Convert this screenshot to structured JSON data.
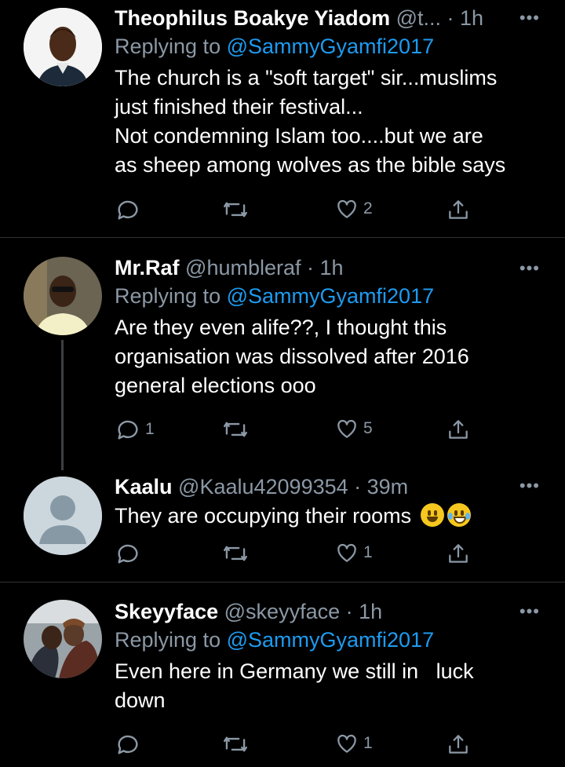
{
  "tweets": [
    {
      "name": "Theophilus Boakye Yiadom",
      "handle": "@t...",
      "time": "· 1h",
      "reply_label": "Replying to",
      "reply_handle": "@SammyGyamfi2017",
      "body_lines": [
        "The church is a \"soft target\" sir...muslims",
        "just finished their festival...",
        "Not condemning Islam too....but we are",
        "as sheep among wolves as the bible says"
      ],
      "replies": "",
      "retweets": "",
      "likes": "2"
    },
    {
      "name": "Mr.Raf",
      "handle": "@humbleraf",
      "time": "· 1h",
      "reply_label": "Replying to",
      "reply_handle": "@SammyGyamfi2017",
      "body_lines": [
        "Are they even alife??, I thought this",
        "organisation was dissolved after 2016",
        "general  elections ooo"
      ],
      "replies": "1",
      "retweets": "",
      "likes": "5"
    },
    {
      "name": "Kaalu",
      "handle": "@Kaalu42099354",
      "time": "· 39m",
      "body_lines": [
        "They are occupying their rooms"
      ],
      "emojis": [
        "grinning-face-emoji",
        "face-with-tears-of-joy-emoji"
      ],
      "replies": "",
      "retweets": "",
      "likes": "1"
    },
    {
      "name": "Skeyyface",
      "handle": "@skeyyface",
      "time": "· 1h",
      "reply_label": "Replying to",
      "reply_handle": "@SammyGyamfi2017",
      "body_lines": [
        "Even here in Germany we still in   luck",
        "down"
      ],
      "replies": "",
      "retweets": "",
      "likes": "1"
    }
  ],
  "more_glyph": "•••",
  "colors": {
    "background": "#000000",
    "text": "#ffffff",
    "secondary": "#8b98a5",
    "mention": "#1d9bf0",
    "divider": "#2f3336"
  }
}
